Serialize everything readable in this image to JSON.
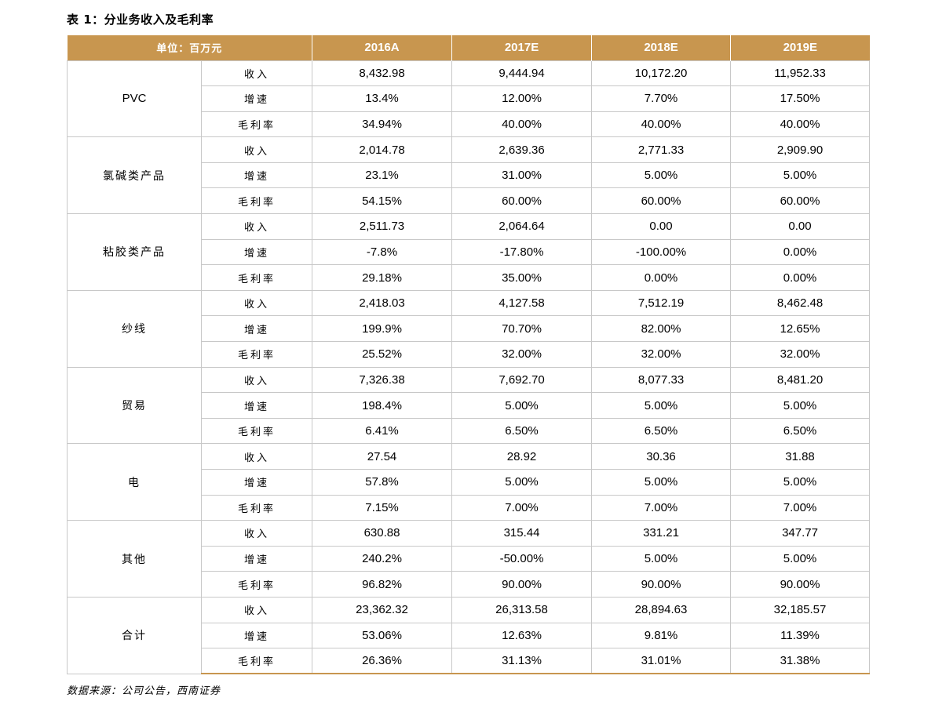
{
  "title": "表 1：分业务收入及毛利率",
  "header": {
    "unit": "单位：百万元",
    "years": [
      "2016A",
      "2017E",
      "2018E",
      "2019E"
    ]
  },
  "segments": [
    {
      "name": "PVC",
      "rows": [
        {
          "metric": "收入",
          "values": [
            "8,432.98",
            "9,444.94",
            "10,172.20",
            "11,952.33"
          ]
        },
        {
          "metric": "增速",
          "values": [
            "13.4%",
            "12.00%",
            "7.70%",
            "17.50%"
          ]
        },
        {
          "metric": "毛利率",
          "values": [
            "34.94%",
            "40.00%",
            "40.00%",
            "40.00%"
          ]
        }
      ]
    },
    {
      "name": "氯碱类产品",
      "rows": [
        {
          "metric": "收入",
          "values": [
            "2,014.78",
            "2,639.36",
            "2,771.33",
            "2,909.90"
          ]
        },
        {
          "metric": "增速",
          "values": [
            "23.1%",
            "31.00%",
            "5.00%",
            "5.00%"
          ]
        },
        {
          "metric": "毛利率",
          "values": [
            "54.15%",
            "60.00%",
            "60.00%",
            "60.00%"
          ]
        }
      ]
    },
    {
      "name": "粘胶类产品",
      "rows": [
        {
          "metric": "收入",
          "values": [
            "2,511.73",
            "2,064.64",
            "0.00",
            "0.00"
          ]
        },
        {
          "metric": "增速",
          "values": [
            "-7.8%",
            "-17.80%",
            "-100.00%",
            "0.00%"
          ]
        },
        {
          "metric": "毛利率",
          "values": [
            "29.18%",
            "35.00%",
            "0.00%",
            "0.00%"
          ]
        }
      ]
    },
    {
      "name": "纱线",
      "rows": [
        {
          "metric": "收入",
          "values": [
            "2,418.03",
            "4,127.58",
            "7,512.19",
            "8,462.48"
          ]
        },
        {
          "metric": "增速",
          "values": [
            "199.9%",
            "70.70%",
            "82.00%",
            "12.65%"
          ]
        },
        {
          "metric": "毛利率",
          "values": [
            "25.52%",
            "32.00%",
            "32.00%",
            "32.00%"
          ]
        }
      ]
    },
    {
      "name": "贸易",
      "rows": [
        {
          "metric": "收入",
          "values": [
            "7,326.38",
            "7,692.70",
            "8,077.33",
            "8,481.20"
          ]
        },
        {
          "metric": "增速",
          "values": [
            "198.4%",
            "5.00%",
            "5.00%",
            "5.00%"
          ]
        },
        {
          "metric": "毛利率",
          "values": [
            "6.41%",
            "6.50%",
            "6.50%",
            "6.50%"
          ]
        }
      ]
    },
    {
      "name": "电",
      "rows": [
        {
          "metric": "收入",
          "values": [
            "27.54",
            "28.92",
            "30.36",
            "31.88"
          ]
        },
        {
          "metric": "增速",
          "values": [
            "57.8%",
            "5.00%",
            "5.00%",
            "5.00%"
          ]
        },
        {
          "metric": "毛利率",
          "values": [
            "7.15%",
            "7.00%",
            "7.00%",
            "7.00%"
          ]
        }
      ]
    },
    {
      "name": "其他",
      "rows": [
        {
          "metric": "收入",
          "values": [
            "630.88",
            "315.44",
            "331.21",
            "347.77"
          ]
        },
        {
          "metric": "增速",
          "values": [
            "240.2%",
            "-50.00%",
            "5.00%",
            "5.00%"
          ]
        },
        {
          "metric": "毛利率",
          "values": [
            "96.82%",
            "90.00%",
            "90.00%",
            "90.00%"
          ]
        }
      ]
    },
    {
      "name": "合计",
      "rows": [
        {
          "metric": "收入",
          "values": [
            "23,362.32",
            "26,313.58",
            "28,894.63",
            "32,185.57"
          ]
        },
        {
          "metric": "增速",
          "values": [
            "53.06%",
            "12.63%",
            "9.81%",
            "11.39%"
          ]
        },
        {
          "metric": "毛利率",
          "values": [
            "26.36%",
            "31.13%",
            "31.01%",
            "31.38%"
          ]
        }
      ]
    }
  ],
  "source": "数据来源：公司公告，西南证券",
  "colors": {
    "header_bg": "#c8964f",
    "header_text": "#ffffff",
    "grid": "#c8c8c8"
  }
}
